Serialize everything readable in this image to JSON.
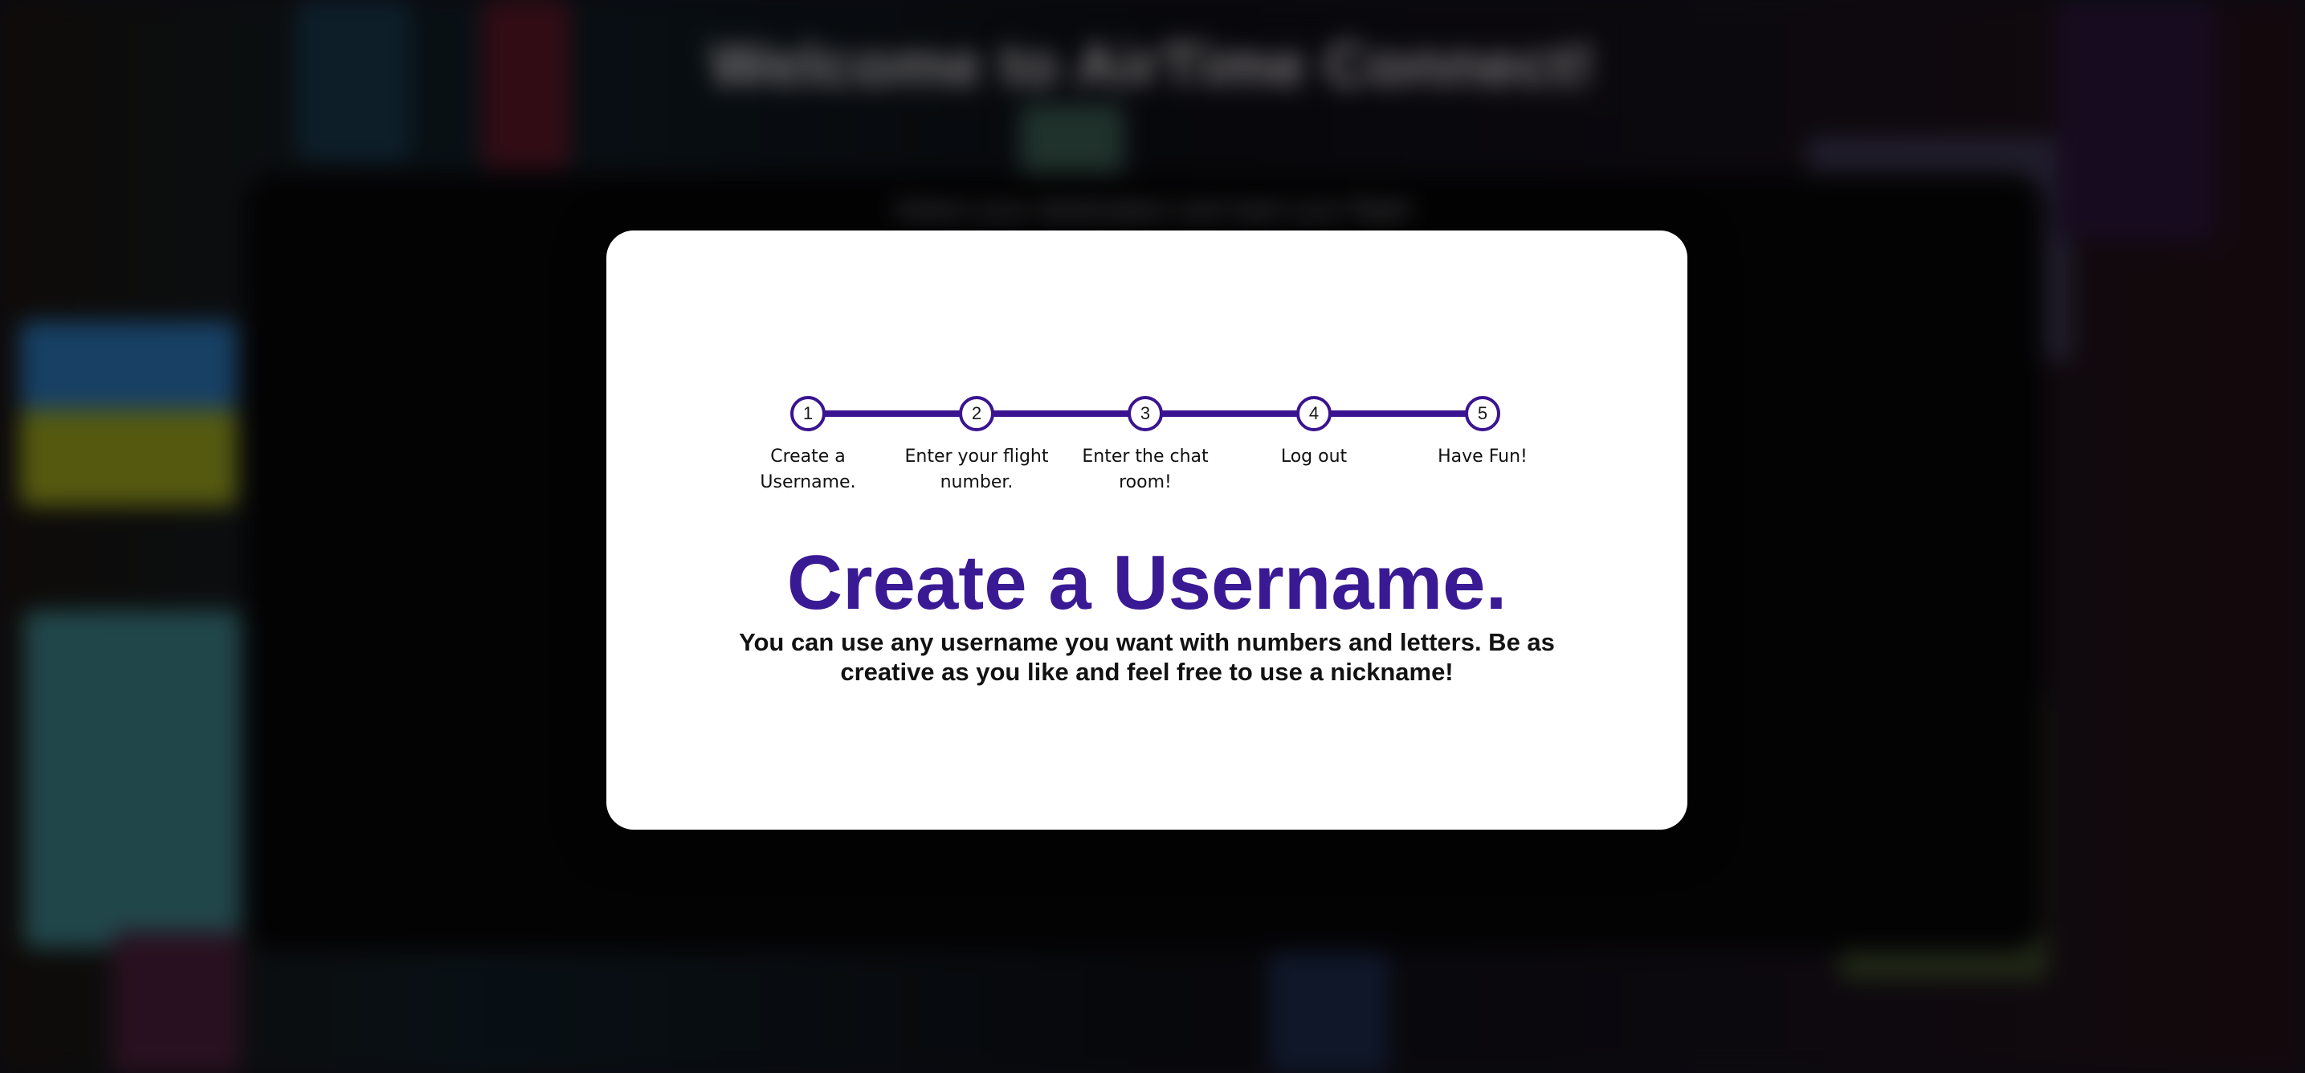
{
  "background": {
    "title": "Welcome to AirTime Connect!",
    "subtitle": "Select your destination and start your flight"
  },
  "tutorial": {
    "steps": [
      {
        "number": "1",
        "label": "Create a Username."
      },
      {
        "number": "2",
        "label": "Enter your flight number."
      },
      {
        "number": "3",
        "label": "Enter the chat room!"
      },
      {
        "number": "4",
        "label": "Log out"
      },
      {
        "number": "5",
        "label": "Have Fun!"
      }
    ],
    "active_step": 1,
    "heading": "Create a Username.",
    "description": "You can use any username you want with numbers and letters. Be as creative as you like and feel free to use a nickname!"
  },
  "colors": {
    "accent": "#3a1a94",
    "track": "#3a1490",
    "modal_bg": "#ffffff"
  }
}
